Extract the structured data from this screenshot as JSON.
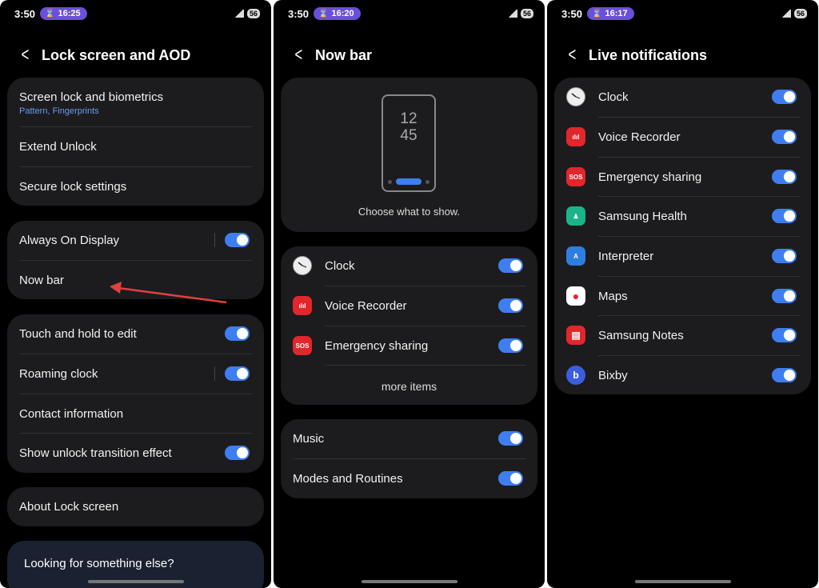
{
  "screen1": {
    "status": {
      "time": "3:50",
      "timer": "16:25",
      "battery": "56"
    },
    "title": "Lock screen and AOD",
    "group1": {
      "screen_lock": "Screen lock and biometrics",
      "screen_lock_sub": "Pattern, Fingerprints",
      "extend_unlock": "Extend Unlock",
      "secure_lock": "Secure lock settings"
    },
    "group2": {
      "aod": "Always On Display",
      "now_bar": "Now bar"
    },
    "group3": {
      "touch_hold": "Touch and hold to edit",
      "roaming_clock": "Roaming clock",
      "contact_info": "Contact information",
      "unlock_transition": "Show unlock transition effect"
    },
    "about": "About Lock screen",
    "looking": "Looking for something else?"
  },
  "screen2": {
    "status": {
      "time": "3:50",
      "timer": "16:20",
      "battery": "56"
    },
    "title": "Now bar",
    "preview": {
      "hour": "12",
      "minute": "45",
      "caption": "Choose what to show."
    },
    "items": [
      {
        "label": "Clock",
        "icon": "clock-icon",
        "on": true
      },
      {
        "label": "Voice Recorder",
        "icon": "voice-recorder-icon",
        "on": true
      },
      {
        "label": "Emergency sharing",
        "icon": "emergency-sharing-icon",
        "on": true
      }
    ],
    "more_items": "more items",
    "group2": {
      "music": "Music",
      "modes": "Modes and Routines"
    }
  },
  "screen3": {
    "status": {
      "time": "3:50",
      "timer": "16:17",
      "battery": "56"
    },
    "title": "Live notifications",
    "items": [
      {
        "label": "Clock",
        "icon": "clock-icon",
        "on": true
      },
      {
        "label": "Voice Recorder",
        "icon": "voice-recorder-icon",
        "on": true
      },
      {
        "label": "Emergency sharing",
        "icon": "emergency-sharing-icon",
        "on": true
      },
      {
        "label": "Samsung Health",
        "icon": "samsung-health-icon",
        "on": true
      },
      {
        "label": "Interpreter",
        "icon": "interpreter-icon",
        "on": true
      },
      {
        "label": "Maps",
        "icon": "maps-icon",
        "on": true
      },
      {
        "label": "Samsung Notes",
        "icon": "samsung-notes-icon",
        "on": true
      },
      {
        "label": "Bixby",
        "icon": "bixby-icon",
        "on": true
      }
    ]
  },
  "colors": {
    "accent": "#3e7ef0",
    "card": "#1c1c1e",
    "sub_text": "#6b9cf3",
    "timer_pill": "#6a4fd8",
    "annotation_arrow": "#e04040"
  }
}
